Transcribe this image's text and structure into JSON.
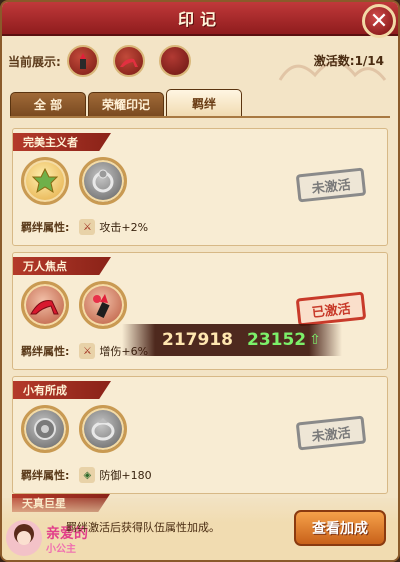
{
  "window": {
    "title": "印记"
  },
  "display": {
    "label": "当前展示:",
    "activation_text": "激活数:1/14"
  },
  "tabs": [
    {
      "label": "全 部",
      "active": false
    },
    {
      "label": "荣耀印记",
      "active": false
    },
    {
      "label": "羁绊",
      "active": true
    }
  ],
  "cards": [
    {
      "title": "完美主义者",
      "status": "未激活",
      "attr_label": "羁绊属性:",
      "attr_value": "攻击+2%",
      "badges": [
        "gold-medal-icon",
        "silver-ring-icon"
      ]
    },
    {
      "title": "万人焦点",
      "status": "已激活",
      "attr_label": "羁绊属性:",
      "attr_value": "增伤+6%",
      "badges": [
        "high-heel-icon",
        "lipstick-icon"
      ]
    },
    {
      "title": "小有所成",
      "status": "未激活",
      "attr_label": "羁绊属性:",
      "attr_value": "防御+180",
      "badges": [
        "emblem-icon",
        "ring-icon"
      ]
    }
  ],
  "next_card_title": "天真巨星",
  "power": {
    "total": "217918",
    "gain": "23152"
  },
  "footer": {
    "tip": "羁绊激活后获得队伍属性加成。",
    "button": "查看加成",
    "logo_text": "亲爱的小公主"
  },
  "colors": {
    "title_red": "#8f1c1d",
    "panel": "#f3e4c6",
    "button_orange": "#c8611a",
    "gain_green": "#7cf06a"
  }
}
